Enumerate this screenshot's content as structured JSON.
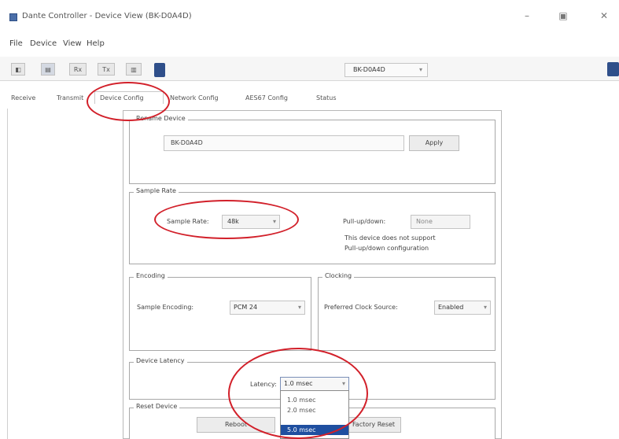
{
  "window": {
    "title": "Dante Controller - Device View (BK-D0A4D)",
    "controls": {
      "minimize": "–",
      "maximize": "▣",
      "close": "✕"
    }
  },
  "menu": [
    "File",
    "Device",
    "View",
    "Help"
  ],
  "toolbar": {
    "buttons": [
      "◧",
      "▤",
      "Rx",
      "Tx",
      "▥"
    ],
    "device_selector": "BK-D0A4D",
    "device_selector_arrow": "▾"
  },
  "tabs": [
    {
      "label": "Receive",
      "active": false
    },
    {
      "label": "Transmit",
      "active": false
    },
    {
      "label": "Device Config",
      "active": true
    },
    {
      "label": "Network Config",
      "active": false
    },
    {
      "label": "AES67 Config",
      "active": false
    },
    {
      "label": "Status",
      "active": false
    }
  ],
  "rename_device": {
    "legend": "Rename Device",
    "input_value": "BK-D0A4D",
    "apply_label": "Apply"
  },
  "sample_rate": {
    "legend": "Sample Rate",
    "label": "Sample Rate:",
    "value": "48k",
    "pullup_label": "Pull-up/down:",
    "pullup_value": "None",
    "note_line1": "This device does not support",
    "note_line2": "Pull-up/down configuration"
  },
  "encoding": {
    "legend": "Encoding",
    "label": "Sample Encoding:",
    "value": "PCM 24"
  },
  "clocking": {
    "legend": "Clocking",
    "label": "Preferred Clock Source:",
    "value": "Enabled"
  },
  "device_latency": {
    "legend": "Device Latency",
    "label": "Latency:",
    "value": "1.0 msec",
    "options": [
      "1.0 msec",
      "2.0 msec",
      "5.0 msec"
    ],
    "selected_index": 2
  },
  "reset_device": {
    "legend": "Reset Device",
    "reboot_label": "Reboot",
    "factory_label": "Factory Reset"
  },
  "colors": {
    "annotation": "#d2202a",
    "selection": "#1f4fa0"
  }
}
